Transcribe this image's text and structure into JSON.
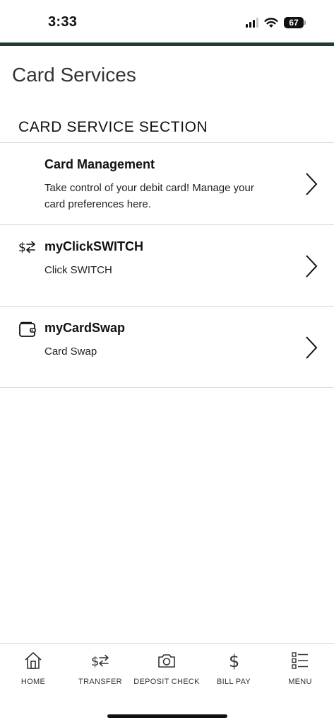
{
  "status_bar": {
    "time": "3:33",
    "battery": "67"
  },
  "page": {
    "title": "Card Services"
  },
  "section": {
    "header": "CARD SERVICE SECTION"
  },
  "services": [
    {
      "title": "Card Management",
      "description": "Take control of your debit card! Manage your card preferences here.",
      "icon": "none"
    },
    {
      "title": "myClickSWITCH",
      "description": "Click SWITCH",
      "icon": "dollar-transfer-icon"
    },
    {
      "title": "myCardSwap",
      "description": "Card Swap",
      "icon": "wallet-icon"
    }
  ],
  "tabs": [
    {
      "label": "HOME",
      "icon": "home-icon"
    },
    {
      "label": "TRANSFER",
      "icon": "transfer-icon"
    },
    {
      "label": "DEPOSIT CHECK",
      "icon": "camera-icon"
    },
    {
      "label": "BILL PAY",
      "icon": "dollar-icon"
    },
    {
      "label": "MENU",
      "icon": "menu-list-icon"
    }
  ],
  "colors": {
    "accent": "#1f3d33",
    "divider": "#d6d6d6",
    "text": "#111111"
  }
}
